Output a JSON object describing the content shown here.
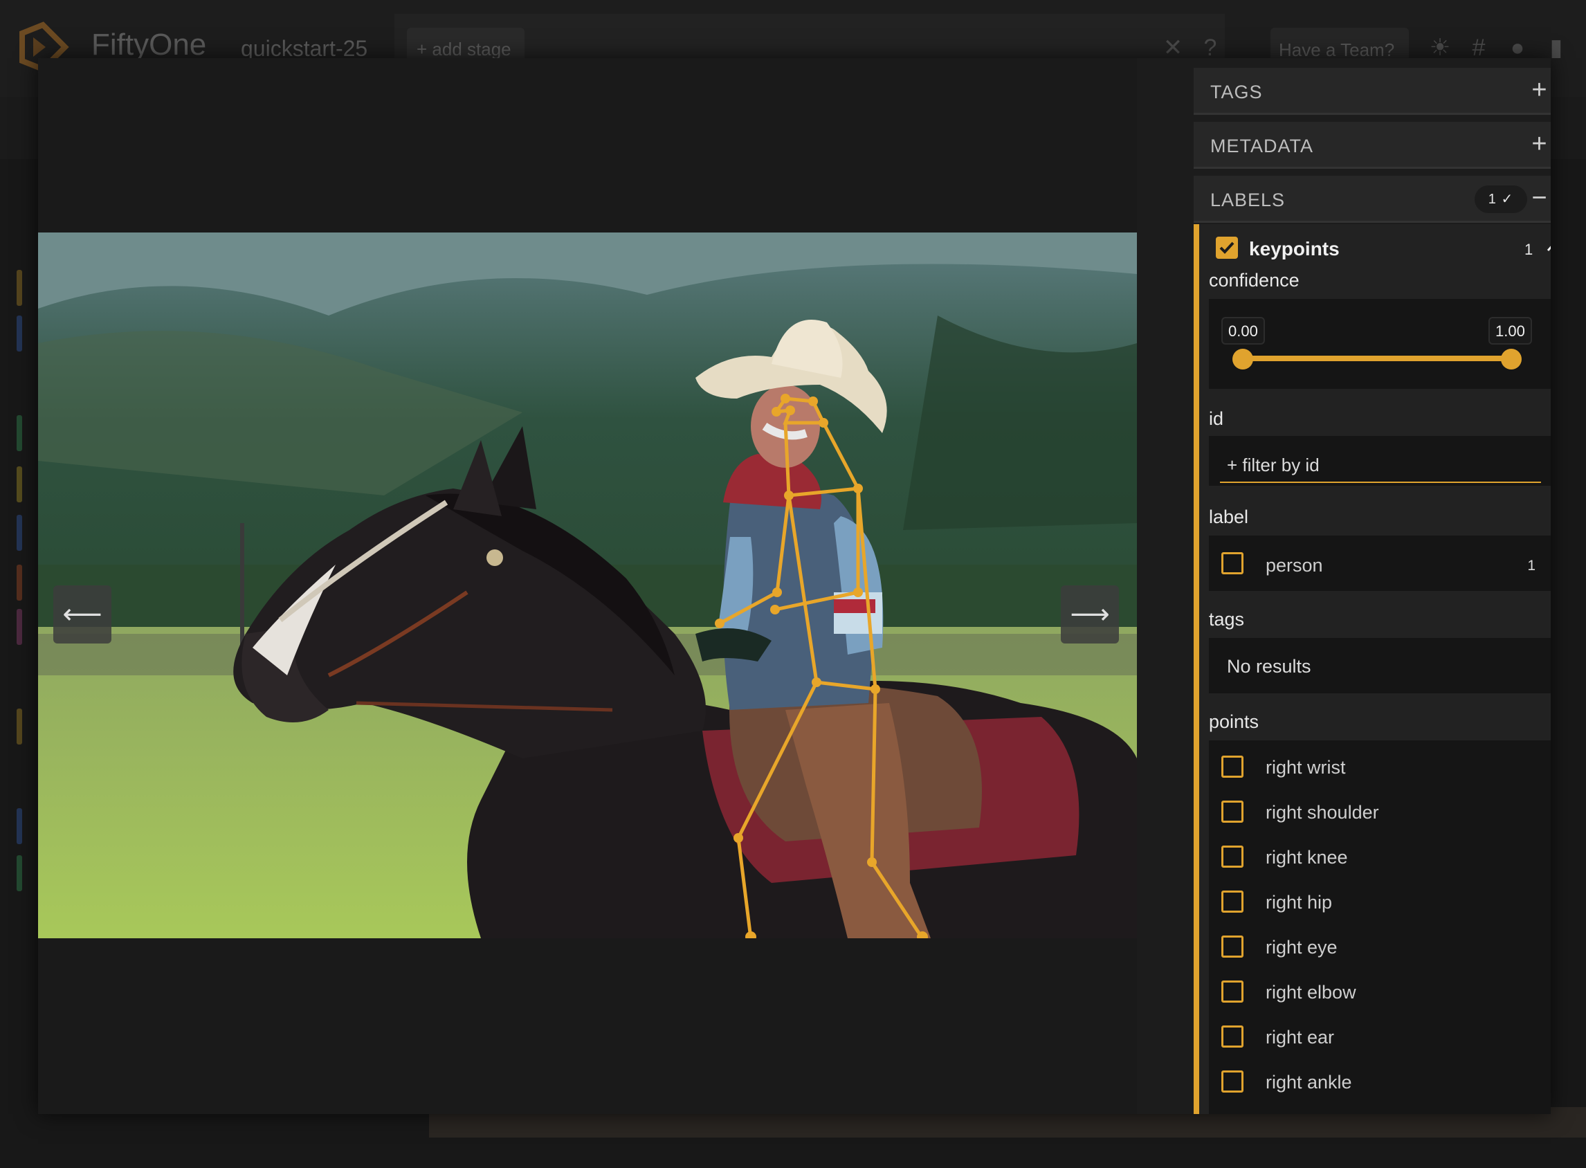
{
  "app": {
    "title": "FiftyOne",
    "dataset": "quickstart-25",
    "add_stage": "+ add stage",
    "have_team": "Have a Team?"
  },
  "sidebar": {
    "groups": {
      "tags": "TAGS",
      "metadata": "METADATA",
      "labels": "LABELS",
      "labels_count": "1 ✓"
    },
    "field": {
      "name": "keypoints",
      "count": "1",
      "confidence": {
        "label": "confidence",
        "min": "0.00",
        "max": "1.00",
        "range": [
          0.0,
          1.0
        ]
      },
      "id": {
        "label": "id",
        "placeholder": "+ filter by id"
      },
      "label": {
        "label": "label",
        "values": [
          {
            "name": "person",
            "count": "1"
          }
        ]
      },
      "tags": {
        "label": "tags",
        "empty": "No results"
      },
      "points": {
        "label": "points",
        "values": [
          "right wrist",
          "right shoulder",
          "right knee",
          "right hip",
          "right eye",
          "right elbow",
          "right ear",
          "right ankle"
        ]
      }
    }
  },
  "colors": {
    "accent": "#e0a32e",
    "background": "#1a1a1a",
    "panel": "#222222"
  },
  "icons": {
    "prev": "arrow-left-icon",
    "next": "arrow-right-icon",
    "add": "plus-icon",
    "collapse": "minus-icon",
    "expand": "chevron-up-icon",
    "close": "close-icon",
    "help": "help-icon",
    "theme": "sun-icon",
    "slack": "slack-icon",
    "github": "github-icon",
    "book": "book-icon"
  }
}
